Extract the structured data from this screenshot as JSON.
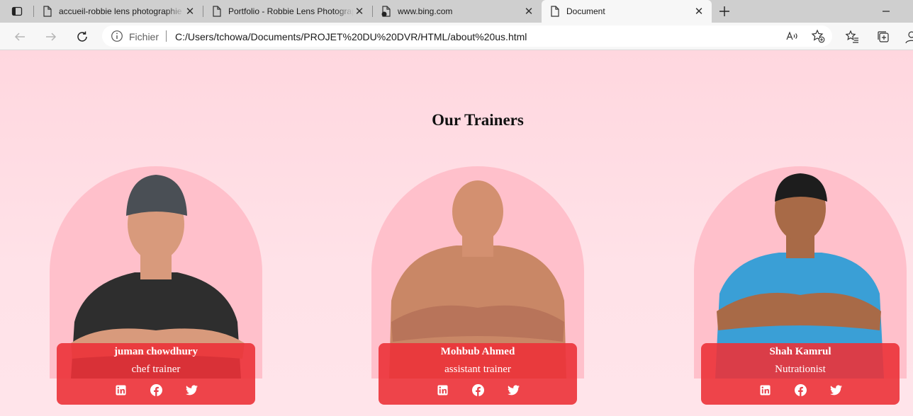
{
  "browser": {
    "tabs": [
      {
        "title": "accueil-robbie lens photographie"
      },
      {
        "title": "Portfolio - Robbie Lens Photographie"
      },
      {
        "title": "www.bing.com"
      },
      {
        "title": "Document"
      }
    ],
    "close_glyph": "✕",
    "address": {
      "scheme_label": "Fichier",
      "url": "C:/Users/tchowa/Documents/PROJET%20DU%20DVR/HTML/about%20us.html"
    }
  },
  "page": {
    "section_title": "Our Trainers",
    "trainers": [
      {
        "name": "juman chowdhury",
        "role": "chef trainer",
        "shirt_color": "#2e2e2e",
        "skin_color": "#d89a7c"
      },
      {
        "name": "Mohbub Ahmed",
        "role": "assistant trainer",
        "shirt_color": "#c98766",
        "skin_color": "#d39070"
      },
      {
        "name": "Shah Kamrul",
        "role": "Nutrationist",
        "shirt_color": "#3a9fd6",
        "skin_color": "#a86a47"
      }
    ],
    "social_icons": [
      "linkedin-icon",
      "facebook-icon",
      "twitter-icon"
    ]
  },
  "colors": {
    "page_background": "#ffdde3",
    "arch_background": "#ffc0cb",
    "info_background": "#ec3238"
  }
}
